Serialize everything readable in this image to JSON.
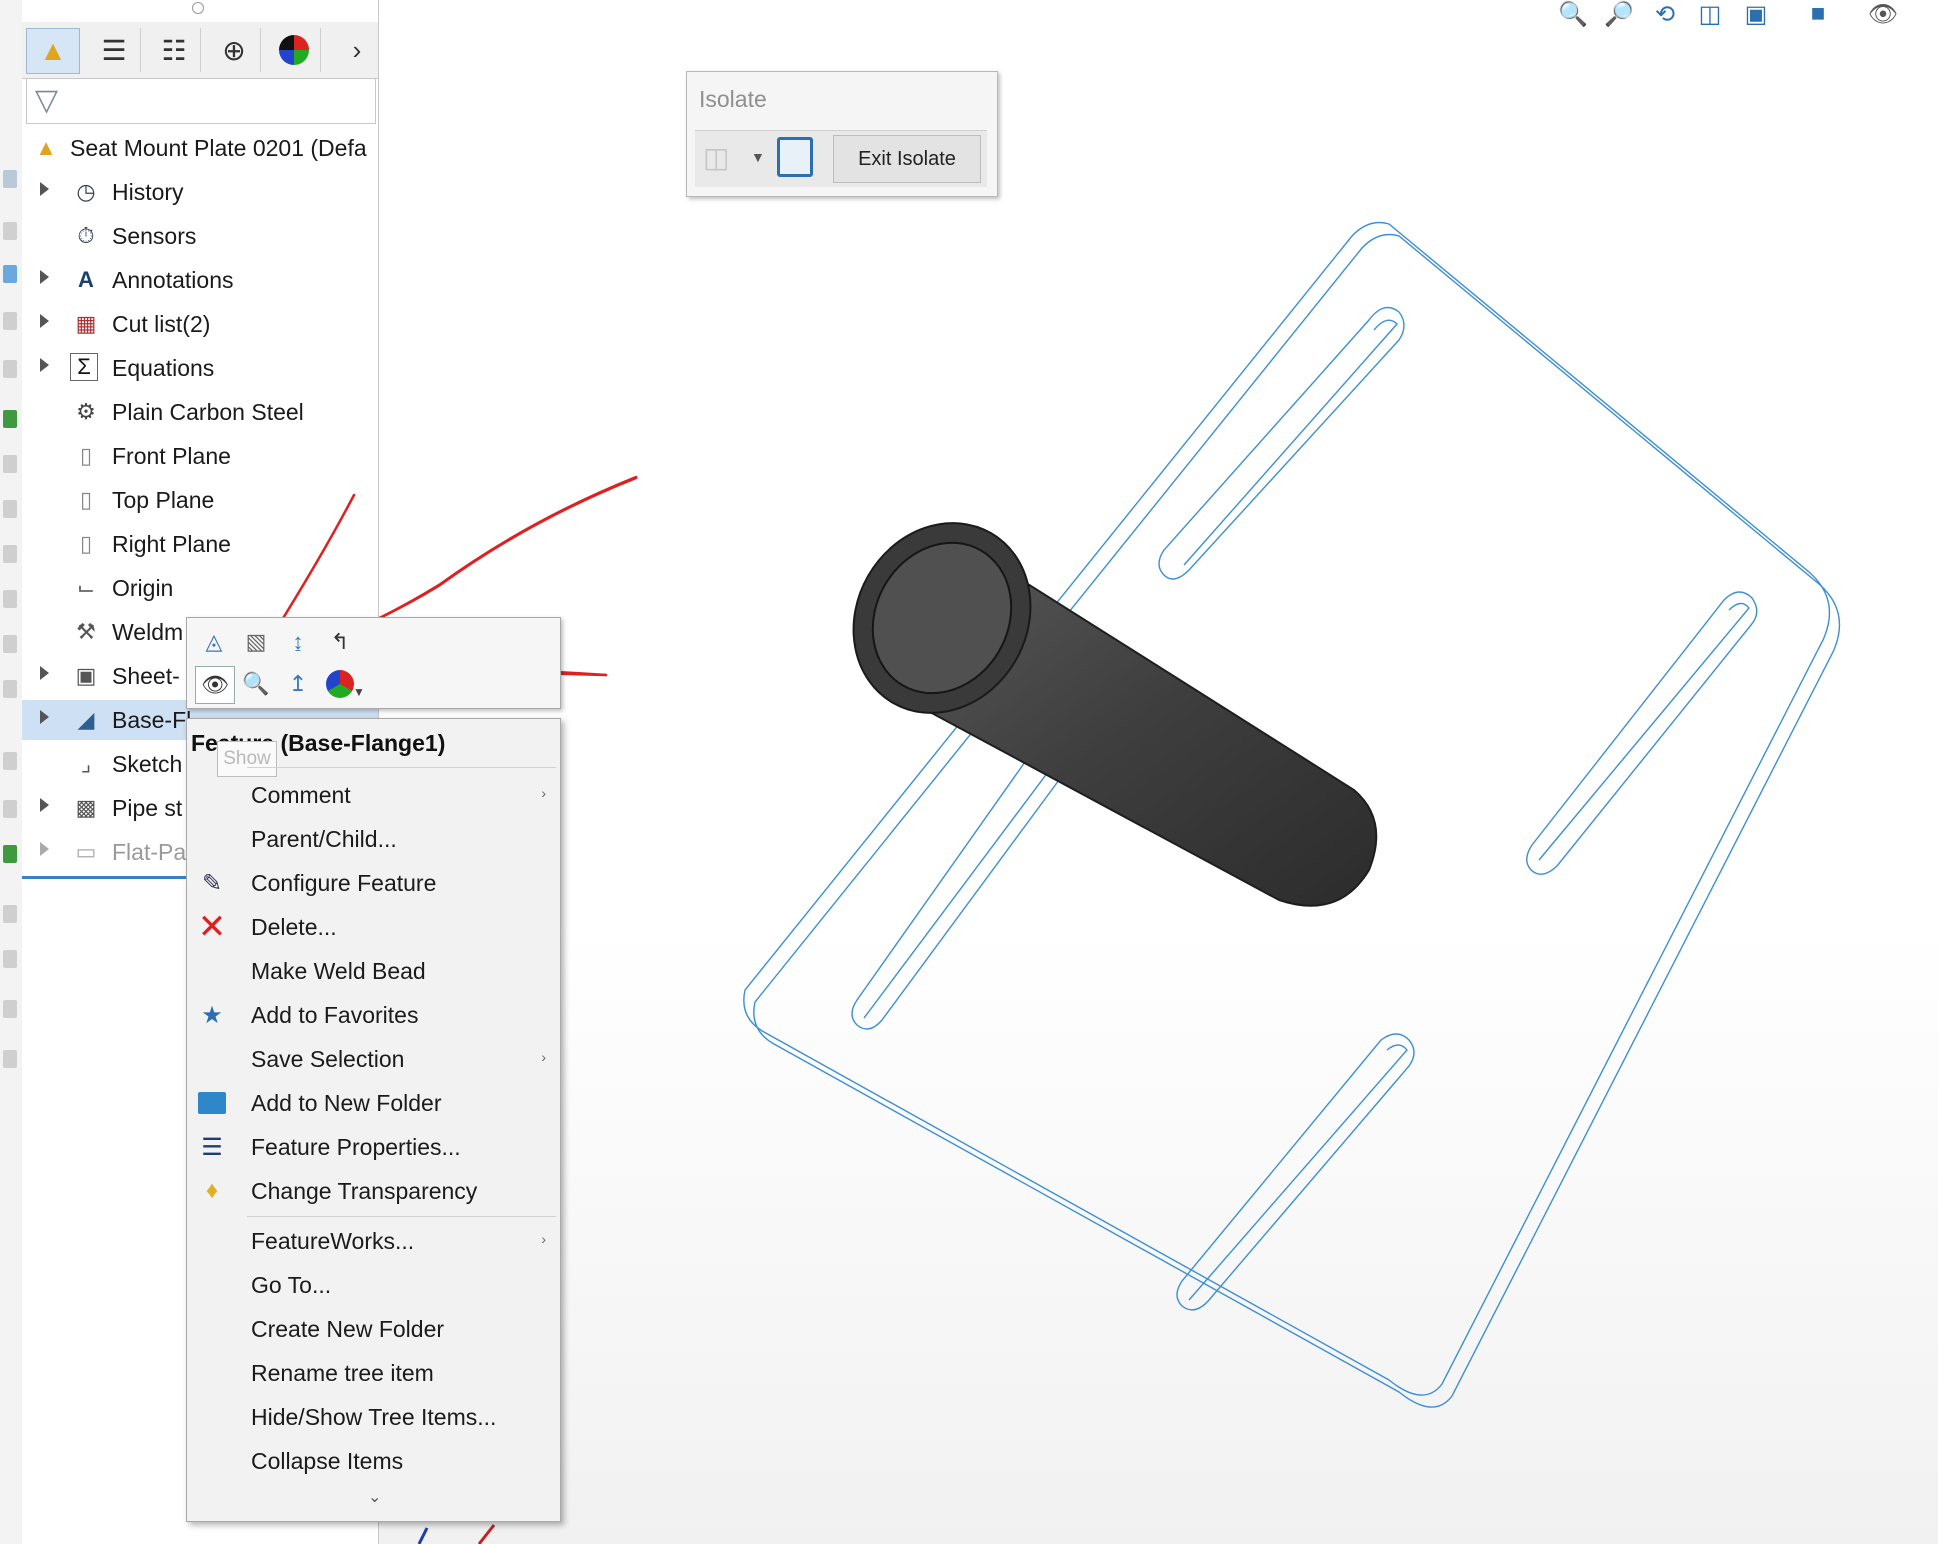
{
  "tree": {
    "root": "Seat Mount Plate 0201 (Defa",
    "items": [
      {
        "label": "History",
        "icon": "history-icon",
        "expandable": true
      },
      {
        "label": "Sensors",
        "icon": "sensors-icon",
        "expandable": false
      },
      {
        "label": "Annotations",
        "icon": "annotations-icon",
        "expandable": true
      },
      {
        "label": "Cut list(2)",
        "icon": "cut-list-icon",
        "expandable": true
      },
      {
        "label": "Equations",
        "icon": "equations-icon",
        "expandable": true
      },
      {
        "label": "Plain Carbon Steel",
        "icon": "material-icon",
        "expandable": false
      },
      {
        "label": "Front Plane",
        "icon": "plane-icon",
        "expandable": false
      },
      {
        "label": "Top Plane",
        "icon": "plane-icon",
        "expandable": false
      },
      {
        "label": "Right Plane",
        "icon": "plane-icon",
        "expandable": false
      },
      {
        "label": "Origin",
        "icon": "origin-icon",
        "expandable": false
      },
      {
        "label": "Weldm",
        "icon": "weldment-icon",
        "expandable": false
      },
      {
        "label": "Sheet-",
        "icon": "sheet-metal-icon",
        "expandable": true
      },
      {
        "label": "Base-Fl",
        "icon": "base-flange-icon",
        "expandable": true,
        "selected": true
      },
      {
        "label": "Sketch",
        "icon": "sketch-icon",
        "expandable": false
      },
      {
        "label": "Pipe st",
        "icon": "pipe-icon",
        "expandable": true
      },
      {
        "label": "Flat-Pa",
        "icon": "flat-pattern-icon",
        "expandable": true,
        "dim": true
      }
    ]
  },
  "isolate": {
    "title": "Isolate",
    "exit_label": "Exit Isolate"
  },
  "context_menu": {
    "header": "Feature (Base-Flange1)",
    "tooltip": "Show",
    "items": [
      {
        "label": "Comment",
        "submenu": true
      },
      {
        "label": "Parent/Child...",
        "submenu": false
      },
      {
        "label": "Configure Feature",
        "icon": "configure-feature-icon"
      },
      {
        "label": "Delete...",
        "icon": "delete-icon"
      },
      {
        "label": "Make Weld Bead"
      },
      {
        "label": "Add to Favorites",
        "icon": "favorites-icon"
      },
      {
        "label": "Save Selection",
        "submenu": true
      },
      {
        "label": "Add to New Folder",
        "icon": "folder-icon"
      },
      {
        "label": "Feature Properties...",
        "icon": "properties-icon"
      },
      {
        "label": "Change Transparency",
        "icon": "transparency-icon"
      },
      {
        "label": "FeatureWorks...",
        "submenu": true
      },
      {
        "label": "Go To..."
      },
      {
        "label": "Create New Folder"
      },
      {
        "label": "Rename tree item"
      },
      {
        "label": "Hide/Show Tree Items..."
      },
      {
        "label": "Collapse Items"
      }
    ],
    "more": "⌄"
  },
  "colors": {
    "wireframe": "#3d8fd6",
    "cylinder": "#444444",
    "annotation": "#e02020",
    "selection": "#cde0f4"
  }
}
